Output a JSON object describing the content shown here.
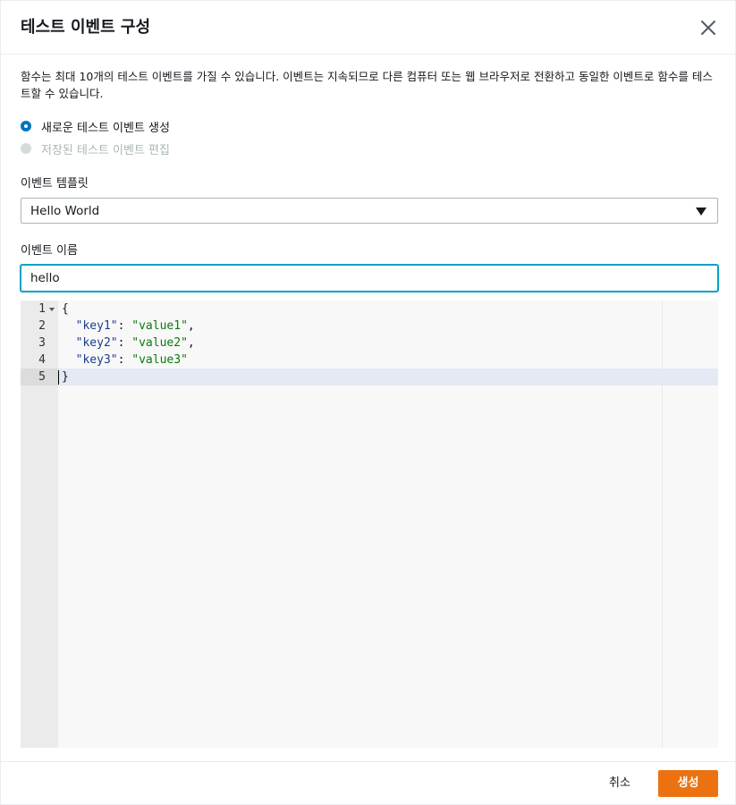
{
  "dialog": {
    "title": "테스트 이벤트 구성",
    "description": "함수는 최대 10개의 테스트 이벤트를 가질 수 있습니다. 이벤트는 지속되므로 다른 컴퓨터 또는 웹 브라우저로 전환하고 동일한 이벤트로 함수를 테스트할 수 있습니다."
  },
  "radios": [
    {
      "label": "새로운 테스트 이벤트 생성",
      "checked": true,
      "disabled": false
    },
    {
      "label": "저장된 테스트 이벤트 편집",
      "checked": false,
      "disabled": true
    }
  ],
  "template": {
    "label": "이벤트 템플릿",
    "value": "Hello World"
  },
  "event_name": {
    "label": "이벤트 이름",
    "value": "hello"
  },
  "editor": {
    "line_numbers": [
      "1",
      "2",
      "3",
      "4",
      "5"
    ],
    "lines": [
      {
        "open": "{"
      },
      {
        "key": "\"key1\"",
        "sep": ": ",
        "val": "\"value1\"",
        "end": ","
      },
      {
        "key": "\"key2\"",
        "sep": ": ",
        "val": "\"value2\"",
        "end": ","
      },
      {
        "key": "\"key3\"",
        "sep": ": ",
        "val": "\"value3\"",
        "end": ""
      },
      {
        "close": "}"
      }
    ]
  },
  "footer": {
    "cancel_label": "취소",
    "create_label": "생성"
  },
  "colors": {
    "accent": "#ec7211",
    "focus": "#00a1c9",
    "radio": "#0073bb"
  }
}
